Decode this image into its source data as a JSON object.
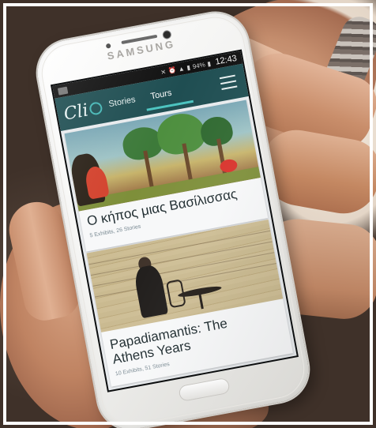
{
  "device": {
    "brand": "SAMSUNG"
  },
  "status_bar": {
    "battery": "94%",
    "time": "12:43"
  },
  "app": {
    "logo_text": "Cli",
    "tabs": [
      {
        "label": "Stories",
        "active": false
      },
      {
        "label": "Tours",
        "active": true
      }
    ],
    "menu_icon": "hamburger-menu-icon",
    "accent_color": "#4cc4c0",
    "header_color": "#1f4e52"
  },
  "cards": [
    {
      "title": "Ο κήπος μιας Βασίλισσας",
      "subtitle": "5 Exhibits, 26 Stories"
    },
    {
      "title": "Papadiamantis: The Athens Years",
      "subtitle": "10 Exhibits, 51 Stories"
    }
  ]
}
